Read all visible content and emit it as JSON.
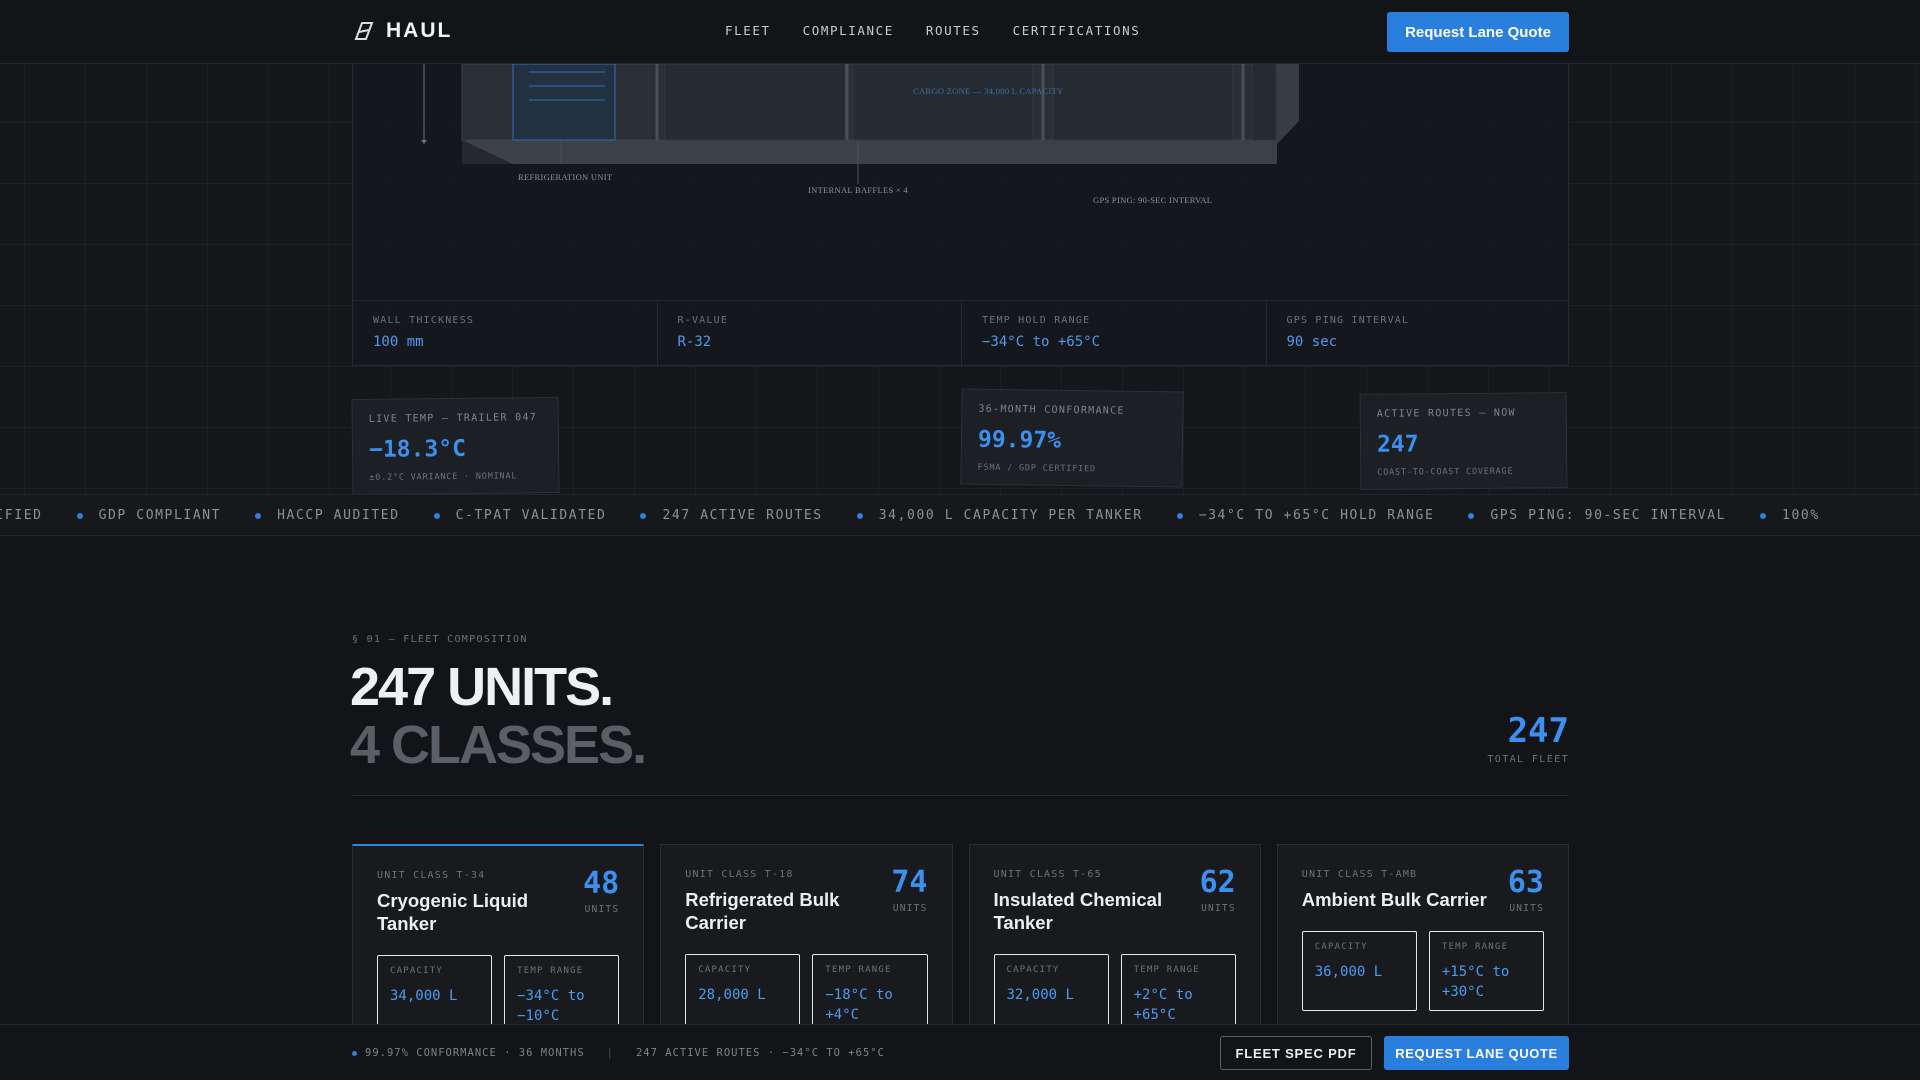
{
  "header": {
    "brand": "HAUL",
    "nav": [
      "FLEET",
      "COMPLIANCE",
      "ROUTES",
      "CERTIFICATIONS"
    ],
    "cta": "Request Lane Quote"
  },
  "schematic": {
    "labels": {
      "refrigeration": "REFRIGERATION UNIT",
      "baffles": "INTERNAL BAFFLES × 4",
      "gps": "GPS PING: 90-SEC INTERVAL",
      "cargo": "CARGO ZONE — 34,000 L CAPACITY"
    },
    "specs": [
      {
        "label": "WALL THICKNESS",
        "value": "100 mm"
      },
      {
        "label": "R-VALUE",
        "value": "R-32"
      },
      {
        "label": "TEMP HOLD RANGE",
        "value": "−34°C to +65°C"
      },
      {
        "label": "GPS PING INTERVAL",
        "value": "90 sec"
      }
    ]
  },
  "readouts": {
    "live_temp": {
      "label": "LIVE TEMP — TRAILER 047",
      "value": "−18.3°C",
      "sub": "±0.2°C VARIANCE · NOMINAL"
    },
    "conformance": {
      "label": "36-MONTH CONFORMANCE",
      "value": "99.97%",
      "sub": "FSMA / GDP CERTIFIED"
    },
    "routes": {
      "label": "ACTIVE ROUTES — NOW",
      "value": "247",
      "sub": "COAST-TO-COAST COVERAGE"
    }
  },
  "ticker": [
    "TIFIED",
    "GDP COMPLIANT",
    "HACCP AUDITED",
    "C-TPAT VALIDATED",
    "247 ACTIVE ROUTES",
    "34,000 L CAPACITY PER TANKER",
    "−34°C TO +65°C HOLD RANGE",
    "GPS PING: 90-SEC INTERVAL",
    "100%"
  ],
  "fleet": {
    "eyebrow": "§ 01 — FLEET COMPOSITION",
    "headline_1": "247 UNITS.",
    "headline_2": "4 CLASSES.",
    "total": "247",
    "total_label": "TOTAL FLEET",
    "units_label": "UNITS",
    "capacity_label": "CAPACITY",
    "temp_label": "TEMP RANGE",
    "cards": [
      {
        "class": "UNIT CLASS T-34",
        "title": "Cryogenic Liquid Tanker",
        "count": "48",
        "capacity": "34,000 L",
        "temp": "−34°C to −10°C"
      },
      {
        "class": "UNIT CLASS T-18",
        "title": "Refrigerated Bulk Carrier",
        "count": "74",
        "capacity": "28,000 L",
        "temp": "−18°C to +4°C"
      },
      {
        "class": "UNIT CLASS T-65",
        "title": "Insulated Chemical Tanker",
        "count": "62",
        "capacity": "32,000 L",
        "temp": "+2°C to +65°C"
      },
      {
        "class": "UNIT CLASS T-AMB",
        "title": "Ambient Bulk Carrier",
        "count": "63",
        "capacity": "36,000 L",
        "temp": "+15°C to +30°C"
      }
    ]
  },
  "bottom_bar": {
    "status_1": "99.97% CONFORMANCE · 36 MONTHS",
    "separator": "|",
    "status_2": "247 ACTIVE ROUTES · −34°C TO +65°C",
    "secondary_cta": "FLEET SPEC PDF",
    "primary_cta": "REQUEST LANE QUOTE"
  },
  "colors": {
    "accent": "#2a7fdc",
    "background": "#121418",
    "value_blue": "#4d9af0"
  }
}
